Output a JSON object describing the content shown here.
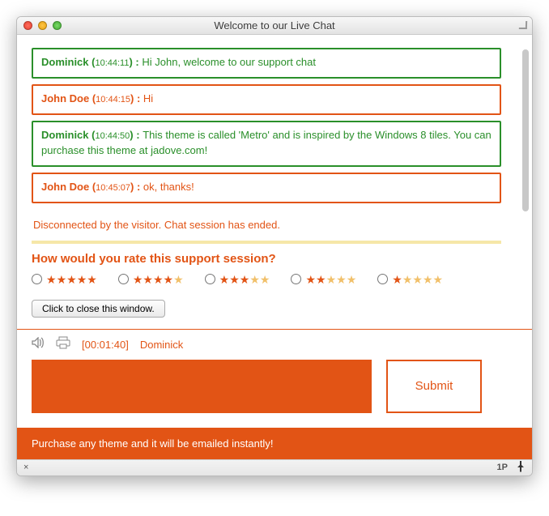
{
  "window": {
    "title": "Welcome to our Live Chat"
  },
  "messages": [
    {
      "role": "agent",
      "sender": "Dominick",
      "time": "10:44:11",
      "text": "Hi John, welcome to our support chat"
    },
    {
      "role": "user",
      "sender": "John Doe",
      "time": "10:44:15",
      "text": "Hi"
    },
    {
      "role": "agent",
      "sender": "Dominick",
      "time": "10:44:50",
      "text": "This theme is called 'Metro' and is inspired by the Windows 8 tiles. You can purchase this theme at jadove.com!"
    },
    {
      "role": "user",
      "sender": "John Doe",
      "time": "10:45:07",
      "text": "ok, thanks!"
    }
  ],
  "status_text": "Disconnected by the visitor. Chat session has ended.",
  "rating": {
    "title": "How would you rate this support session?",
    "options": [
      5,
      4,
      3,
      2,
      1
    ]
  },
  "close_button": "Click to close this window.",
  "toolbar": {
    "duration": "[00:01:40]",
    "operator": "Dominick"
  },
  "submit_label": "Submit",
  "footer_text": "Purchase any theme and it will be emailed instantly!",
  "statusbar": {
    "close_glyph": "×",
    "ext_label": "1P"
  }
}
